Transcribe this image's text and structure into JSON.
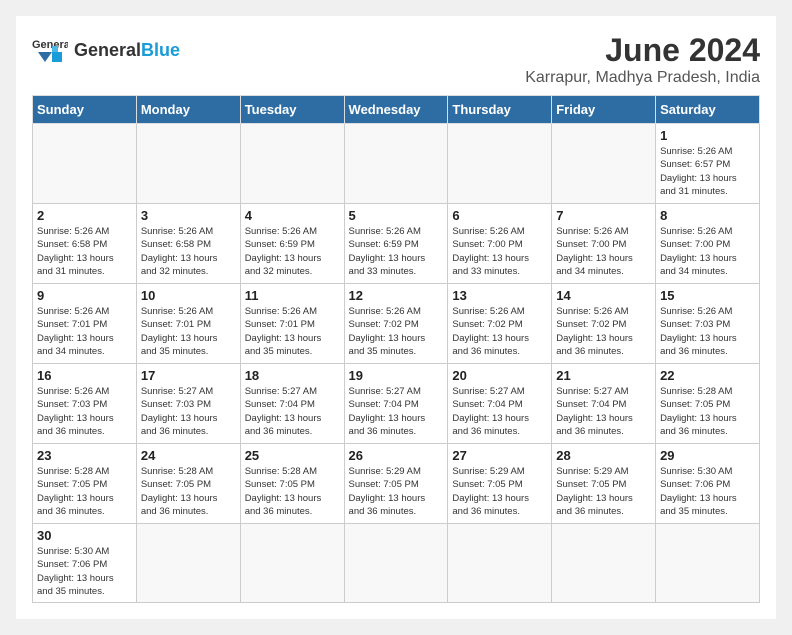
{
  "header": {
    "logo_text_normal": "General",
    "logo_text_bold": "Blue",
    "main_title": "June 2024",
    "subtitle": "Karrapur, Madhya Pradesh, India"
  },
  "weekdays": [
    "Sunday",
    "Monday",
    "Tuesday",
    "Wednesday",
    "Thursday",
    "Friday",
    "Saturday"
  ],
  "weeks": [
    [
      {
        "day": null
      },
      {
        "day": null
      },
      {
        "day": null
      },
      {
        "day": null
      },
      {
        "day": null
      },
      {
        "day": null
      },
      {
        "day": 1,
        "sunrise": "Sunrise: 5:26 AM",
        "sunset": "Sunset: 6:57 PM",
        "daylight": "Daylight: 13 hours and 31 minutes."
      }
    ],
    [
      {
        "day": 2,
        "sunrise": "Sunrise: 5:26 AM",
        "sunset": "Sunset: 6:58 PM",
        "daylight": "Daylight: 13 hours and 31 minutes."
      },
      {
        "day": 3,
        "sunrise": "Sunrise: 5:26 AM",
        "sunset": "Sunset: 6:58 PM",
        "daylight": "Daylight: 13 hours and 32 minutes."
      },
      {
        "day": 4,
        "sunrise": "Sunrise: 5:26 AM",
        "sunset": "Sunset: 6:59 PM",
        "daylight": "Daylight: 13 hours and 32 minutes."
      },
      {
        "day": 5,
        "sunrise": "Sunrise: 5:26 AM",
        "sunset": "Sunset: 6:59 PM",
        "daylight": "Daylight: 13 hours and 33 minutes."
      },
      {
        "day": 6,
        "sunrise": "Sunrise: 5:26 AM",
        "sunset": "Sunset: 7:00 PM",
        "daylight": "Daylight: 13 hours and 33 minutes."
      },
      {
        "day": 7,
        "sunrise": "Sunrise: 5:26 AM",
        "sunset": "Sunset: 7:00 PM",
        "daylight": "Daylight: 13 hours and 34 minutes."
      },
      {
        "day": 8,
        "sunrise": "Sunrise: 5:26 AM",
        "sunset": "Sunset: 7:00 PM",
        "daylight": "Daylight: 13 hours and 34 minutes."
      }
    ],
    [
      {
        "day": 9,
        "sunrise": "Sunrise: 5:26 AM",
        "sunset": "Sunset: 7:01 PM",
        "daylight": "Daylight: 13 hours and 34 minutes."
      },
      {
        "day": 10,
        "sunrise": "Sunrise: 5:26 AM",
        "sunset": "Sunset: 7:01 PM",
        "daylight": "Daylight: 13 hours and 35 minutes."
      },
      {
        "day": 11,
        "sunrise": "Sunrise: 5:26 AM",
        "sunset": "Sunset: 7:01 PM",
        "daylight": "Daylight: 13 hours and 35 minutes."
      },
      {
        "day": 12,
        "sunrise": "Sunrise: 5:26 AM",
        "sunset": "Sunset: 7:02 PM",
        "daylight": "Daylight: 13 hours and 35 minutes."
      },
      {
        "day": 13,
        "sunrise": "Sunrise: 5:26 AM",
        "sunset": "Sunset: 7:02 PM",
        "daylight": "Daylight: 13 hours and 36 minutes."
      },
      {
        "day": 14,
        "sunrise": "Sunrise: 5:26 AM",
        "sunset": "Sunset: 7:02 PM",
        "daylight": "Daylight: 13 hours and 36 minutes."
      },
      {
        "day": 15,
        "sunrise": "Sunrise: 5:26 AM",
        "sunset": "Sunset: 7:03 PM",
        "daylight": "Daylight: 13 hours and 36 minutes."
      }
    ],
    [
      {
        "day": 16,
        "sunrise": "Sunrise: 5:26 AM",
        "sunset": "Sunset: 7:03 PM",
        "daylight": "Daylight: 13 hours and 36 minutes."
      },
      {
        "day": 17,
        "sunrise": "Sunrise: 5:27 AM",
        "sunset": "Sunset: 7:03 PM",
        "daylight": "Daylight: 13 hours and 36 minutes."
      },
      {
        "day": 18,
        "sunrise": "Sunrise: 5:27 AM",
        "sunset": "Sunset: 7:04 PM",
        "daylight": "Daylight: 13 hours and 36 minutes."
      },
      {
        "day": 19,
        "sunrise": "Sunrise: 5:27 AM",
        "sunset": "Sunset: 7:04 PM",
        "daylight": "Daylight: 13 hours and 36 minutes."
      },
      {
        "day": 20,
        "sunrise": "Sunrise: 5:27 AM",
        "sunset": "Sunset: 7:04 PM",
        "daylight": "Daylight: 13 hours and 36 minutes."
      },
      {
        "day": 21,
        "sunrise": "Sunrise: 5:27 AM",
        "sunset": "Sunset: 7:04 PM",
        "daylight": "Daylight: 13 hours and 36 minutes."
      },
      {
        "day": 22,
        "sunrise": "Sunrise: 5:28 AM",
        "sunset": "Sunset: 7:05 PM",
        "daylight": "Daylight: 13 hours and 36 minutes."
      }
    ],
    [
      {
        "day": 23,
        "sunrise": "Sunrise: 5:28 AM",
        "sunset": "Sunset: 7:05 PM",
        "daylight": "Daylight: 13 hours and 36 minutes."
      },
      {
        "day": 24,
        "sunrise": "Sunrise: 5:28 AM",
        "sunset": "Sunset: 7:05 PM",
        "daylight": "Daylight: 13 hours and 36 minutes."
      },
      {
        "day": 25,
        "sunrise": "Sunrise: 5:28 AM",
        "sunset": "Sunset: 7:05 PM",
        "daylight": "Daylight: 13 hours and 36 minutes."
      },
      {
        "day": 26,
        "sunrise": "Sunrise: 5:29 AM",
        "sunset": "Sunset: 7:05 PM",
        "daylight": "Daylight: 13 hours and 36 minutes."
      },
      {
        "day": 27,
        "sunrise": "Sunrise: 5:29 AM",
        "sunset": "Sunset: 7:05 PM",
        "daylight": "Daylight: 13 hours and 36 minutes."
      },
      {
        "day": 28,
        "sunrise": "Sunrise: 5:29 AM",
        "sunset": "Sunset: 7:05 PM",
        "daylight": "Daylight: 13 hours and 36 minutes."
      },
      {
        "day": 29,
        "sunrise": "Sunrise: 5:30 AM",
        "sunset": "Sunset: 7:06 PM",
        "daylight": "Daylight: 13 hours and 35 minutes."
      }
    ],
    [
      {
        "day": 30,
        "sunrise": "Sunrise: 5:30 AM",
        "sunset": "Sunset: 7:06 PM",
        "daylight": "Daylight: 13 hours and 35 minutes."
      },
      {
        "day": null
      },
      {
        "day": null
      },
      {
        "day": null
      },
      {
        "day": null
      },
      {
        "day": null
      },
      {
        "day": null
      }
    ]
  ]
}
